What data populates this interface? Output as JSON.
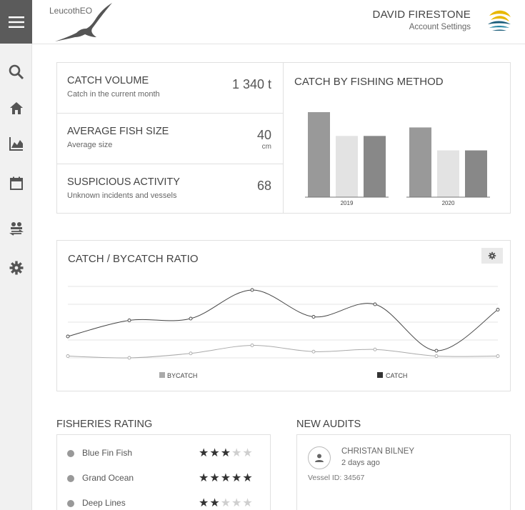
{
  "app": {
    "logo_text": "LeucothEO"
  },
  "user": {
    "name": "DAVID FIRESTONE",
    "settings_label": "Account Settings"
  },
  "sidebar": {
    "items": [
      {
        "icon": "search-icon"
      },
      {
        "icon": "home-icon"
      },
      {
        "icon": "analytics-icon"
      },
      {
        "icon": "calendar-icon"
      },
      {
        "icon": "transfer-icon"
      },
      {
        "icon": "settings-icon"
      }
    ]
  },
  "kpis": [
    {
      "title": "CATCH VOLUME",
      "subtitle": "Catch in the current month",
      "value": "1 340 t",
      "unit": ""
    },
    {
      "title": "AVERAGE FISH SIZE",
      "subtitle": "Average  size",
      "value": "40",
      "unit": "cm"
    },
    {
      "title": "SUSPICIOUS ACTIVITY",
      "subtitle": "Unknown incidents  and vessels",
      "value": "68",
      "unit": ""
    }
  ],
  "method_chart": {
    "title": "CATCH BY FISHING METHOD"
  },
  "ratio_chart": {
    "title": "CATCH / BYCATCH RATIO",
    "legend_bycatch": "BYCATCH",
    "legend_catch": "CATCH"
  },
  "chart_data": [
    {
      "type": "bar",
      "title": "CATCH BY FISHING METHOD",
      "categories": [
        "2019",
        "2020"
      ],
      "series": [
        {
          "values": [
            100,
            82
          ],
          "color": "#999999"
        },
        {
          "values": [
            72,
            55
          ],
          "color": "#e3e3e3"
        },
        {
          "values": [
            72,
            55
          ],
          "color": "#888888"
        }
      ],
      "ylim": [
        0,
        100
      ],
      "grid": false
    },
    {
      "type": "line",
      "title": "CATCH / BYCATCH RATIO",
      "x": [
        0,
        1,
        2,
        3,
        4,
        5,
        6,
        7
      ],
      "series": [
        {
          "name": "CATCH",
          "values": [
            1.2,
            2.1,
            2.2,
            3.8,
            2.3,
            3.0,
            0.4,
            2.7
          ],
          "color": "#444444"
        },
        {
          "name": "BYCATCH",
          "values": [
            0.1,
            0.0,
            0.25,
            0.7,
            0.35,
            0.47,
            0.1,
            0.1
          ],
          "color": "#aaaaaa"
        }
      ],
      "ylim": [
        0,
        4
      ],
      "grid": true,
      "legend": "bottom"
    }
  ],
  "ratings": {
    "title": "FISHERIES RATING",
    "items": [
      {
        "label": "Blue Fin Fish",
        "stars": 3
      },
      {
        "label": "Grand Ocean",
        "stars": 5
      },
      {
        "label": "Deep Lines",
        "stars": 2
      }
    ]
  },
  "audits": {
    "title": "NEW AUDITS",
    "items": [
      {
        "name": "CHRISTAN BILNEY",
        "time": "2 days ago",
        "vessel": "Vessel ID: 34567"
      }
    ]
  },
  "colors": {
    "sidebar_bg": "#f1f1f1",
    "menu_bg": "#5b5b5b",
    "bar_dark": "#999999",
    "bar_light": "#e3e3e3",
    "bar_mid": "#888888",
    "catch_line": "#444444",
    "bycatch_line": "#aaaaaa",
    "brand_yellow": "#e8b800",
    "brand_blue": "#1b5d7a"
  }
}
